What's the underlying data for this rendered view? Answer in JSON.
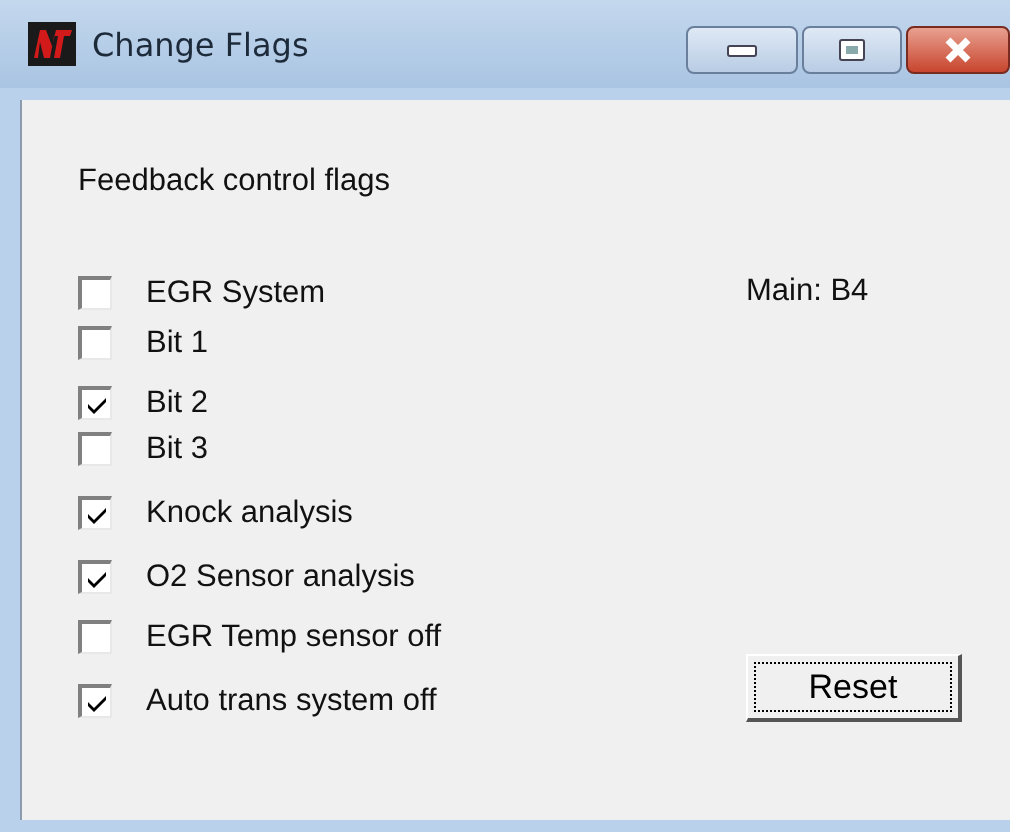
{
  "window": {
    "title": "Change Flags"
  },
  "heading": "Feedback control flags",
  "flags": [
    {
      "label": "EGR System",
      "checked": false
    },
    {
      "label": "Bit 1",
      "checked": false
    },
    {
      "label": "Bit 2",
      "checked": true
    },
    {
      "label": "Bit 3",
      "checked": false
    },
    {
      "label": "Knock analysis",
      "checked": true
    },
    {
      "label": "O2 Sensor analysis",
      "checked": true
    },
    {
      "label": "EGR Temp sensor off",
      "checked": false
    },
    {
      "label": "Auto trans system off",
      "checked": true
    }
  ],
  "main_label": "Main: B4",
  "buttons": [
    "Reset"
  ]
}
